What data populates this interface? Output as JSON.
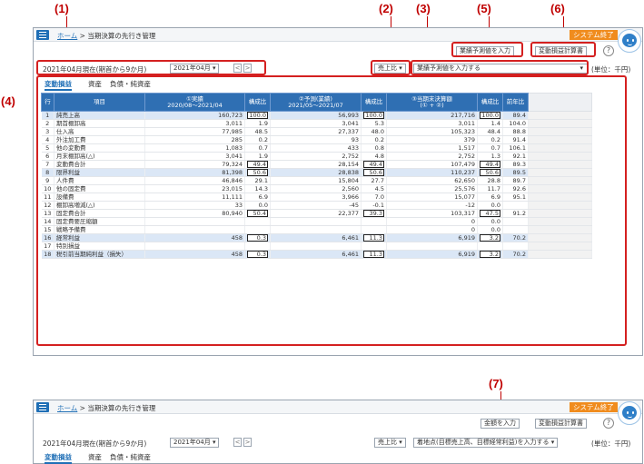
{
  "callouts": [
    "(1)",
    "(2)",
    "(3)",
    "(5)",
    "(6)",
    "(4)",
    "(7)"
  ],
  "header": {
    "breadcrumb_home": "ホーム",
    "breadcrumb_sep": ">",
    "breadcrumb_page": "当期決算の先行き管理",
    "system_exit": "システム終了",
    "forecast_btn": "業績予測値を入力",
    "pl_btn": "変動損益計算書",
    "help": "?"
  },
  "filters": {
    "period_label": "2021年04月現在(期首から9か月)",
    "month_select": "2021年04月",
    "prev": "<",
    "next": ">",
    "ratio_select": "売上比",
    "input_select": "業績予測値を入力する",
    "unit": "(単位：千円)"
  },
  "tabs": [
    "変動損益",
    "資産",
    "負債・純資産"
  ],
  "table": {
    "headers": [
      "行",
      "項目",
      "①実績\n2020/08～2021/04",
      "構成比",
      "②予測(業績)\n2021/05～2021/07",
      "構成比",
      "③当期末決算額\n(① + ②)",
      "構成比",
      "前年比"
    ],
    "rows": [
      {
        "no": "1",
        "item": "純売上高",
        "a": "160,723",
        "ar": "100.0",
        "b": "56,993",
        "br": "100.0",
        "c": "217,716",
        "cr": "100.0",
        "py": "89.4",
        "hl": true,
        "box": true
      },
      {
        "no": "2",
        "item": "期首棚卸高",
        "a": "3,011",
        "ar": "1.9",
        "b": "3,041",
        "br": "5.3",
        "c": "3,011",
        "cr": "1.4",
        "py": "104.0"
      },
      {
        "no": "3",
        "item": "仕入高",
        "a": "77,985",
        "ar": "48.5",
        "b": "27,337",
        "br": "48.0",
        "c": "105,323",
        "cr": "48.4",
        "py": "88.8"
      },
      {
        "no": "4",
        "item": "外注加工費",
        "a": "285",
        "ar": "0.2",
        "b": "93",
        "br": "0.2",
        "c": "379",
        "cr": "0.2",
        "py": "91.4"
      },
      {
        "no": "5",
        "item": "他の変動費",
        "a": "1,083",
        "ar": "0.7",
        "b": "433",
        "br": "0.8",
        "c": "1,517",
        "cr": "0.7",
        "py": "106.1"
      },
      {
        "no": "6",
        "item": "月末棚卸高(△)",
        "a": "3,041",
        "ar": "1.9",
        "b": "2,752",
        "br": "4.8",
        "c": "2,752",
        "cr": "1.3",
        "py": "92.1"
      },
      {
        "no": "7",
        "item": "変動費合計",
        "a": "79,324",
        "ar": "49.4",
        "b": "28,154",
        "br": "49.4",
        "c": "107,479",
        "cr": "49.4",
        "py": "89.3",
        "box": true
      },
      {
        "no": "8",
        "item": "限界利益",
        "a": "81,398",
        "ar": "50.6",
        "b": "28,838",
        "br": "50.6",
        "c": "110,237",
        "cr": "50.6",
        "py": "89.5",
        "hl": true,
        "box": true
      },
      {
        "no": "9",
        "item": "人件費",
        "a": "46,846",
        "ar": "29.1",
        "b": "15,804",
        "br": "27.7",
        "c": "62,650",
        "cr": "28.8",
        "py": "89.7"
      },
      {
        "no": "10",
        "item": "他の固定費",
        "a": "23,015",
        "ar": "14.3",
        "b": "2,560",
        "br": "4.5",
        "c": "25,576",
        "cr": "11.7",
        "py": "92.6"
      },
      {
        "no": "11",
        "item": "設備費",
        "a": "11,111",
        "ar": "6.9",
        "b": "3,966",
        "br": "7.0",
        "c": "15,077",
        "cr": "6.9",
        "py": "95.1"
      },
      {
        "no": "12",
        "item": "棚卸高増減(△)",
        "a": "33",
        "ar": "0.0",
        "b": "-45",
        "br": "-0.1",
        "c": "-12",
        "cr": "0.0",
        "py": ""
      },
      {
        "no": "13",
        "item": "固定費合計",
        "a": "80,940",
        "ar": "50.4",
        "b": "22,377",
        "br": "39.3",
        "c": "103,317",
        "cr": "47.5",
        "py": "91.2",
        "box": true
      },
      {
        "no": "14",
        "item": "固定費要圧縮額",
        "a": "",
        "ar": "",
        "b": "",
        "br": "",
        "c": "0",
        "cr": "0.0",
        "py": ""
      },
      {
        "no": "15",
        "item": "戦略予備費",
        "a": "",
        "ar": "",
        "b": "",
        "br": "",
        "c": "0",
        "cr": "0.0",
        "py": ""
      },
      {
        "no": "16",
        "item": "経常利益",
        "a": "458",
        "ar": "0.3",
        "b": "6,461",
        "br": "11.3",
        "c": "6,919",
        "cr": "3.2",
        "py": "70.2",
        "hl": true,
        "box": true
      },
      {
        "no": "17",
        "item": "特別損益",
        "a": "",
        "ar": "",
        "b": "",
        "br": "",
        "c": "",
        "cr": "",
        "py": ""
      },
      {
        "no": "18",
        "item": "税引前当期純利益（損失）",
        "a": "458",
        "ar": "0.3",
        "b": "6,461",
        "br": "11.3",
        "c": "6,919",
        "cr": "3.2",
        "py": "70.2",
        "hl": true,
        "box": true
      }
    ]
  },
  "bottom": {
    "amount_btn": "金額を入力",
    "input_select": "着地点(目標売上高、目標経常利益)を入力する"
  }
}
